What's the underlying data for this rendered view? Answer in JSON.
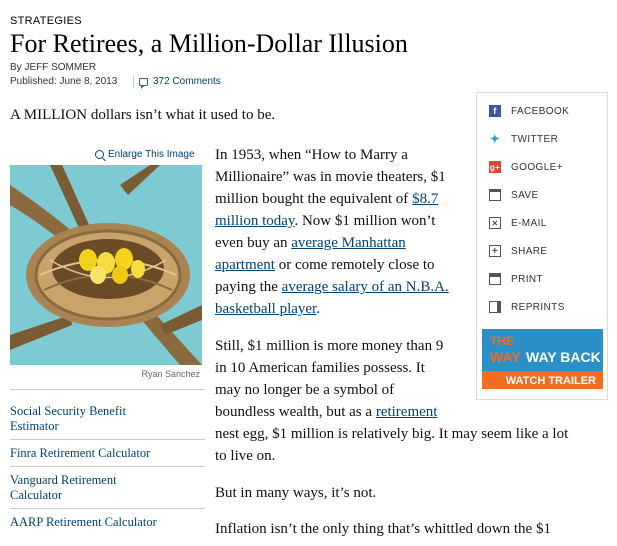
{
  "article": {
    "kicker": "STRATEGIES",
    "headline": "For Retirees, a Million-Dollar Illusion",
    "byline": "By JEFF SOMMER",
    "published": "Published: June 8, 2013",
    "comments": "372 Comments",
    "lead": "A MILLION dollars isn’t what it used to be.",
    "para1": {
      "l1": "In 1953, when “How to Marry a",
      "l2": "Millionaire” was in movie theaters, $1",
      "l3_pre": "million bought the equivalent of ",
      "l3_link": "$8.7",
      "l4_link": "million today",
      "l4_post": ". Now $1 million won’t",
      "l5_pre": "even buy an ",
      "l5_link": "average Manhattan",
      "l6_link": "apartment",
      "l6_post": " or come remotely close to",
      "l7_pre": "paying the ",
      "l7_link": "average salary of an N.B.A.",
      "l8_link": "basketball player",
      "l8_post": "."
    },
    "para2": {
      "l1": "Still, $1 million is more money than 9",
      "l2": "in 10 American families possess. It",
      "l3": "may no longer be a symbol of",
      "l4_pre": "boundless wealth, but as a ",
      "l4_link": "retirement",
      "l5": "nest egg, $1 million is relatively big. It may seem like a lot",
      "l6": "to live on."
    },
    "para3": "But in many ways, it’s not.",
    "para4": "Inflation isn’t the only thing that’s whittled down the $1"
  },
  "image": {
    "enlarge_label": "Enlarge This Image",
    "credit": "Ryan Sanchez"
  },
  "related": [
    {
      "l1": "Social Security Benefit",
      "l2": "Estimator"
    },
    {
      "l1": "Finra Retirement Calculator",
      "l2": ""
    },
    {
      "l1": "Vanguard Retirement",
      "l2": "Calculator"
    },
    {
      "l1": "AARP Retirement Calculator",
      "l2": ""
    }
  ],
  "share": {
    "items": [
      {
        "label": "FACEBOOK",
        "icon": "facebook-icon"
      },
      {
        "label": "TWITTER",
        "icon": "twitter-icon"
      },
      {
        "label": "GOOGLE+",
        "icon": "google-plus-icon"
      },
      {
        "label": "SAVE",
        "icon": "folder-icon"
      },
      {
        "label": "E-MAIL",
        "icon": "envelope-icon"
      },
      {
        "label": "SHARE",
        "icon": "plus-box-icon"
      },
      {
        "label": "PRINT",
        "icon": "printer-icon"
      },
      {
        "label": "REPRINTS",
        "icon": "reprints-icon"
      }
    ]
  },
  "ad": {
    "line1": "THE",
    "line2a": "WAY",
    "line2b": "WAY BACK",
    "cta": "WATCH TRAILER"
  },
  "colors": {
    "link": "#004276",
    "facebook": "#3b5998",
    "twitter": "#2a9fd8",
    "google": "#d24b32",
    "ad_blue": "#2b8fc8",
    "ad_orange": "#f26d21"
  }
}
